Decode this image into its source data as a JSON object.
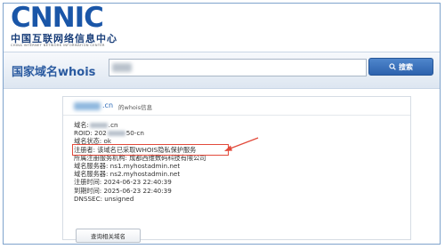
{
  "header": {
    "logo_text": "CNNIC",
    "logo_cn": "中国互联网络信息中心",
    "logo_en": "CHINA INTERNET NETWORK INFORMATION CENTER"
  },
  "search": {
    "title": "国家域名whois",
    "button_label": "搜索"
  },
  "result": {
    "domain_suffix": ".cn",
    "head_label": "的whois信息",
    "rows": [
      {
        "prefix": "域名: ",
        "redacted": true,
        "suffix": ".cn"
      },
      {
        "prefix": "ROID: 202",
        "redacted": true,
        "suffix": "50-cn"
      },
      {
        "prefix": "域名状态: ok",
        "redacted": false,
        "suffix": ""
      },
      {
        "prefix": "注册者: 该域名已采取WHOIS隐私保护服务",
        "redacted": false,
        "suffix": "",
        "highlight": true
      },
      {
        "prefix": "所属注册服务机构: 成都西维数码科技有限公司",
        "redacted": false,
        "suffix": ""
      },
      {
        "prefix": "域名服务器: ns1.myhostadmin.net",
        "redacted": false,
        "suffix": ""
      },
      {
        "prefix": "域名服务器: ns2.myhostadmin.net",
        "redacted": false,
        "suffix": ""
      },
      {
        "prefix": "注册时间: 2024-06-23 22:40:39",
        "redacted": false,
        "suffix": ""
      },
      {
        "prefix": "到期时间: 2025-06-23 22:40:39",
        "redacted": false,
        "suffix": ""
      },
      {
        "prefix": "DNSSEC: unsigned",
        "redacted": false,
        "suffix": ""
      }
    ],
    "query_button": "查询相关域名"
  },
  "colors": {
    "brand": "#1a56a8",
    "button": "#2d62ad",
    "annotation": "#e24a3b"
  },
  "icons": {
    "search_button_icon": "magnifier-icon"
  }
}
